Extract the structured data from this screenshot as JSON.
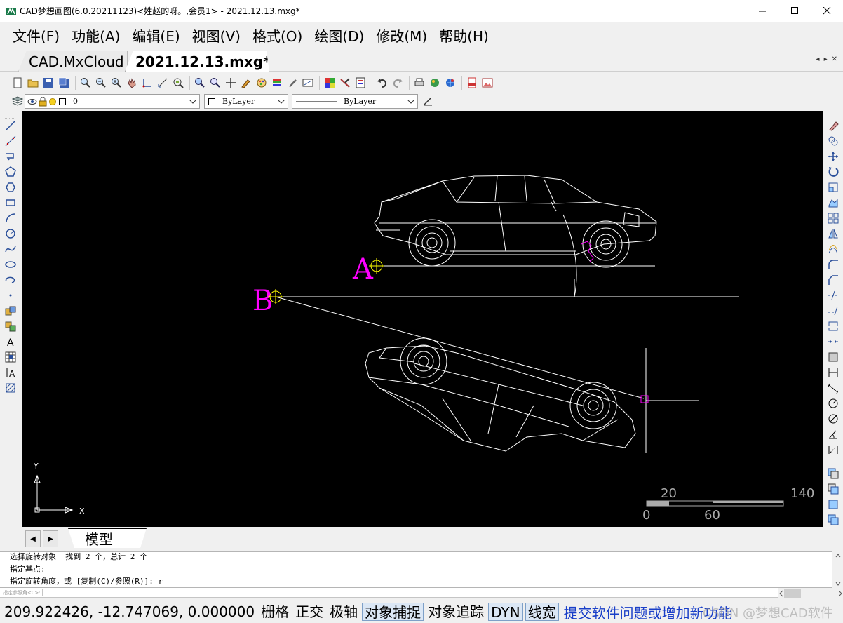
{
  "window": {
    "title": "CAD梦想画图(6.0.20211123)<姓赵的呀。,会员1> - 2021.12.13.mxg*"
  },
  "menu": {
    "items": [
      "文件(F)",
      "功能(A)",
      "编辑(E)",
      "视图(V)",
      "格式(O)",
      "绘图(D)",
      "修改(M)",
      "帮助(H)"
    ]
  },
  "tabs": {
    "items": [
      {
        "label": "CAD.MxCloud"
      },
      {
        "label": "2021.12.13.mxg*"
      }
    ]
  },
  "layer_toolbar": {
    "layer_value": "0",
    "color_value": "ByLayer",
    "linetype_value": "ByLayer"
  },
  "canvas": {
    "point_a_label": "A",
    "point_b_label": "B",
    "ucs_x": "X",
    "ucs_y": "Y",
    "scale_labels": {
      "top_left": "20",
      "top_right": "140",
      "bottom_left": "0",
      "bottom_mid": "60"
    }
  },
  "model_tab": {
    "label": "模型"
  },
  "command": {
    "lines": [
      "选择旋转对象  找到 2 个，总计 2 个",
      "指定基点:",
      "指定旋转角度，或 [复制(C)/参照(R)]: r"
    ],
    "input_prompt": "指定参照角<0>:"
  },
  "status": {
    "coordinates": "209.922426,  -12.747069,  0.000000",
    "toggles": [
      {
        "label": "栅格",
        "on": false
      },
      {
        "label": "正交",
        "on": false
      },
      {
        "label": "极轴",
        "on": false
      },
      {
        "label": "对象捕捉",
        "on": true
      },
      {
        "label": "对象追踪",
        "on": false
      },
      {
        "label": "DYN",
        "on": true
      },
      {
        "label": "线宽",
        "on": true
      }
    ],
    "feedback_link": "提交软件问题或增加新功能",
    "watermark": "CSDN @梦想CAD软件"
  },
  "colors": {
    "canvas_bg": "#000000",
    "drawing_lines": "#ffffff",
    "label_magenta": "#ff00ff",
    "marker_yellow": "#ffff00"
  }
}
